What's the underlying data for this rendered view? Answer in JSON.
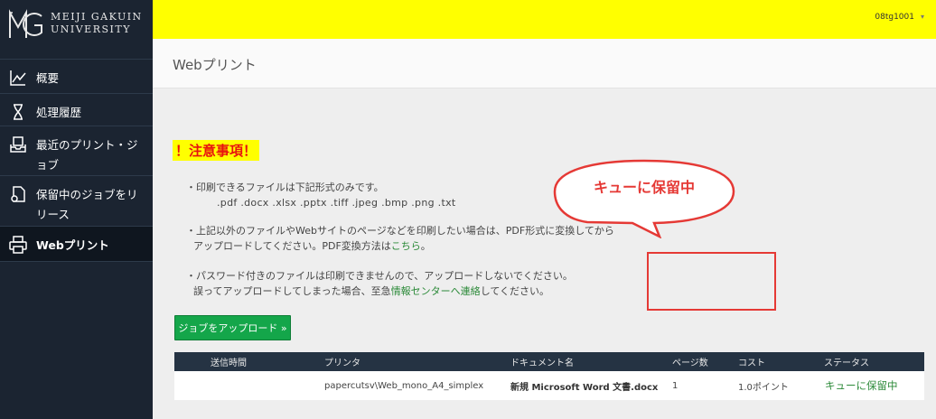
{
  "app": {
    "logo_line1": "MEIJI GAKUIN",
    "logo_line2": "UNIVERSITY",
    "user": "08tg1001",
    "user_caret": "▾"
  },
  "sidebar": {
    "items": [
      {
        "label": "概要",
        "icon": "chart-line-icon"
      },
      {
        "label": "処理履歴",
        "icon": "hourglass-icon"
      },
      {
        "label": "最近のプリント・ジョブ",
        "icon": "printer-tray-icon"
      },
      {
        "label": "保留中のジョブをリリース",
        "icon": "document-release-icon"
      },
      {
        "label": "Webプリント",
        "icon": "printer-icon"
      }
    ]
  },
  "page": {
    "title": "Webプリント",
    "notice_title": "！注意事項！",
    "p1_line1": "・印刷できるファイルは下記形式のみです。",
    "p1_line2": ".pdf   .docx   .xlsx   .pptx   .tiff   .jpeg   .bmp   .png   .txt",
    "p2_line1": "・上記以外のファイルやWebサイトのページなどを印刷したい場合は、PDF形式に変換してから",
    "p2_line2_pre": "アップロードしてください。PDF変換方法は",
    "p2_link": "こちら",
    "p2_line2_post": "。",
    "p3_line1": "・パスワード付きのファイルは印刷できませんので、アップロードしないでください。",
    "p3_line2_pre": "誤ってアップロードしてしまった場合、至急",
    "p3_link": "情報センターへ連絡",
    "p3_line2_post": "してください。",
    "upload_button": "ジョブをアップロード »"
  },
  "table": {
    "headers": [
      "送信時間",
      "プリンタ",
      "ドキュメント名",
      "ページ数",
      "コスト",
      "ステータス"
    ],
    "rows": [
      {
        "time": "",
        "printer": "papercutsv\\Web_mono_A4_simplex",
        "document": "新規 Microsoft Word 文書.docx",
        "pages": "1",
        "cost": "1.0ポイント",
        "status": "キューに保留中"
      }
    ]
  },
  "callout": {
    "text": "キューに保留中"
  },
  "colors": {
    "sidebar_bg": "#1b2431",
    "topbar": "#ffff00",
    "accent_green": "#14a64a",
    "link_green": "#2c8a39",
    "warning_red": "#e53935",
    "table_header": "#253343"
  }
}
